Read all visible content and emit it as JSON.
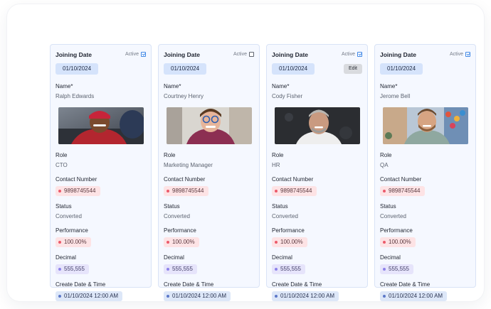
{
  "labels": {
    "joining_date": "Joining Date",
    "active": "Active",
    "name": "Name*",
    "role": "Role",
    "contact": "Contact Number",
    "status": "Status",
    "performance": "Performance",
    "decimal": "Decimal",
    "create_dt": "Create Date & Time",
    "edit": "Edit"
  },
  "colors": {
    "accent": "#3f87e6",
    "card_bg": "#f5f8ff",
    "red_pill": "#fde3e5",
    "purple_pill": "#e6e4fb",
    "blue_pill": "#dde7f8"
  },
  "cards": [
    {
      "active_checked": true,
      "joining_date": "01/10/2024",
      "name": "Ralph Edwards",
      "role": "CTO",
      "contact": "9898745544",
      "status": "Converted",
      "performance": "100.00%",
      "decimal": "555,555",
      "create_dt": "01/10/2024 12:00 AM"
    },
    {
      "active_checked": false,
      "joining_date": "01/10/2024",
      "name": "Courtney Henry",
      "role": "Marketing Manager",
      "contact": "9898745544",
      "status": "Converted",
      "performance": "100.00%",
      "decimal": "555,555",
      "create_dt": "01/10/2024 12:00 AM"
    },
    {
      "active_checked": true,
      "joining_date": "01/10/2024",
      "name": "Cody Fisher",
      "role": "HR",
      "contact": "9898745544",
      "status": "Converted",
      "performance": "100.00%",
      "decimal": "555,555",
      "create_dt": "01/10/2024 12:00 AM"
    },
    {
      "active_checked": true,
      "joining_date": "01/10/2024",
      "name": "Jerome Bell",
      "role": "QA",
      "contact": "9898745544",
      "status": "Converted",
      "performance": "100.00%",
      "decimal": "555,555",
      "create_dt": "01/10/2024 12:00 AM"
    }
  ]
}
